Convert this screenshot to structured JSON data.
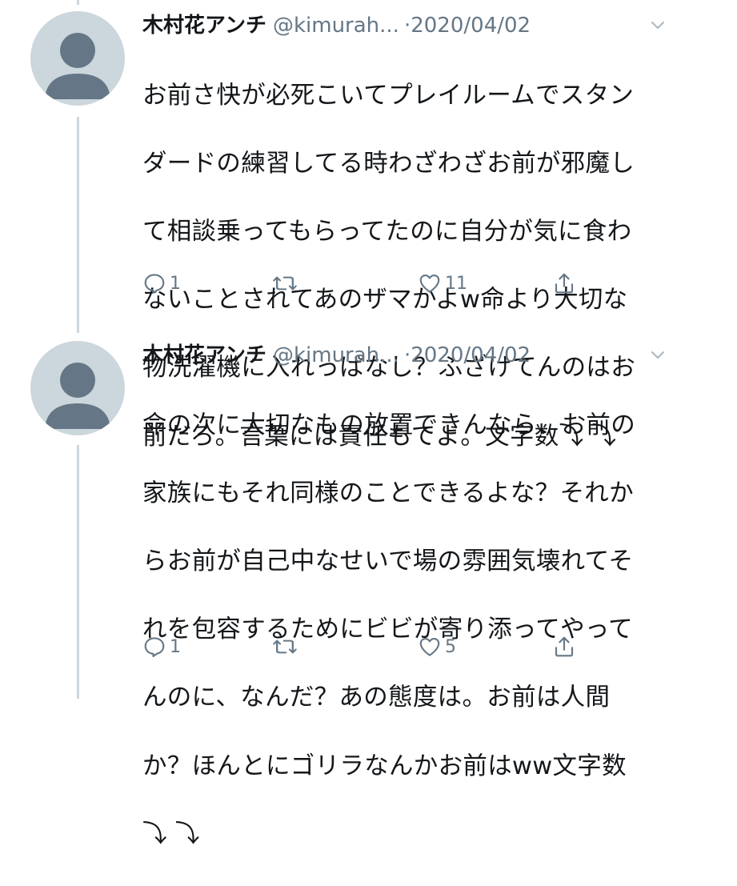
{
  "colors": {
    "text": "#14171a",
    "secondary": "#657786",
    "line": "#ccd6dd",
    "avatar_bg": "#ccd6dd",
    "avatar_fg": "#657786"
  },
  "tweets": [
    {
      "display_name": "木村花アンチ",
      "handle": "@kimurah...",
      "separator": "·",
      "date": "2020/04/02",
      "text_lines": [
        "お前さ快が必死こいてプレイルームでスタン",
        "ダードの練習してる時わざわざお前が邪魔し",
        "て相談乗ってもらってたのに自分が気に食わ",
        "ないことされてあのザマかよw命より大切な",
        "物洗濯機に入れっぱなし？ふざけてんのはお",
        "前だろ。言葉には責任もてよ。文字数⤵︎ ⤵︎"
      ],
      "reply_count": "1",
      "retweet_count": "",
      "like_count": "11",
      "icons": [
        "reply-icon",
        "retweet-icon",
        "like-icon",
        "share-icon"
      ]
    },
    {
      "display_name": "木村花アンチ",
      "handle": "@kimurah...",
      "separator": "·",
      "date": "2020/04/02",
      "text_lines": [
        "命の次に大切なもの放置できんなら、お前の",
        "家族にもそれ同様のことできるよな？それか",
        "らお前が自己中なせいで場の雰囲気壊れてそ",
        "れを包容するためにビビが寄り添ってやって",
        "んのに、なんだ？あの態度は。お前は人間",
        "か？ほんとにゴリラなんかお前はww文字数",
        "⤵︎ ⤵︎"
      ],
      "reply_count": "1",
      "retweet_count": "",
      "like_count": "5",
      "icons": [
        "reply-icon",
        "retweet-icon",
        "like-icon",
        "share-icon"
      ]
    }
  ]
}
